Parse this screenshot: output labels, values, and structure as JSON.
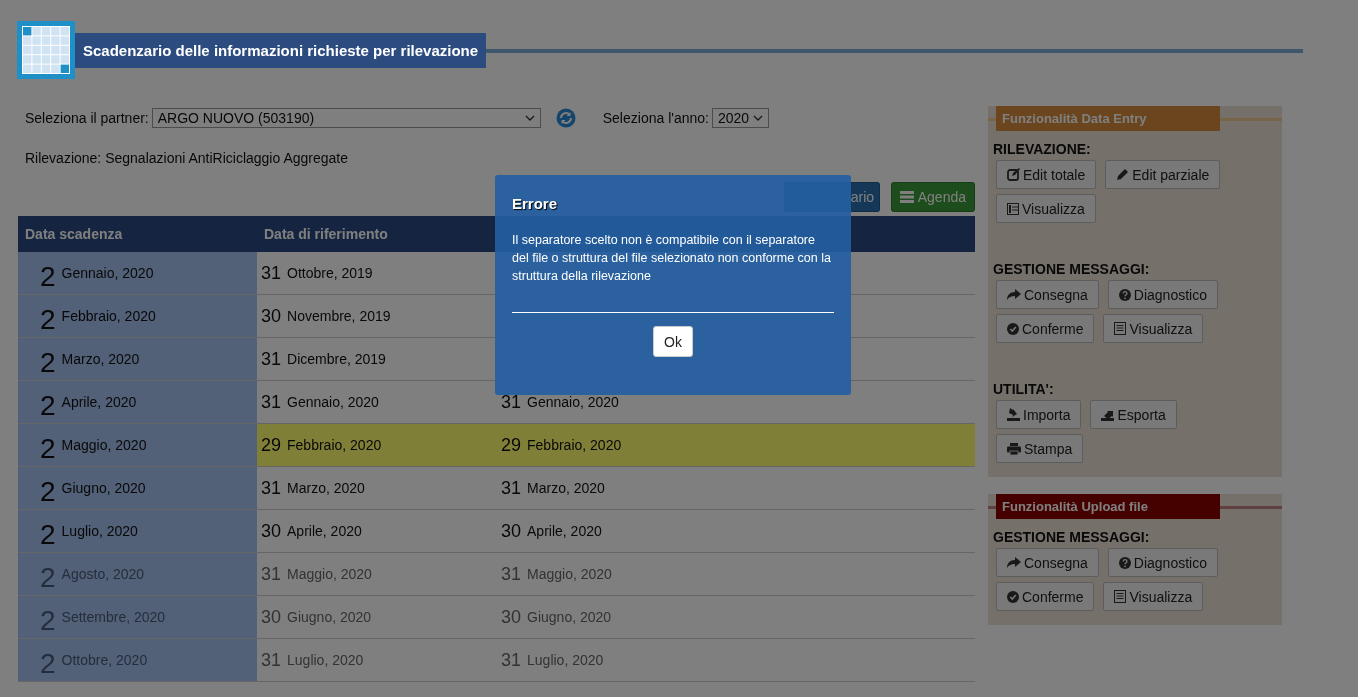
{
  "header": {
    "title": "Scadenzario delle informazioni richieste per rilevazione"
  },
  "filters": {
    "partner_label": "Seleziona il partner:",
    "partner_value": "ARGO NUOVO (503190)",
    "year_label": "Seleziona l'anno:",
    "year_value": "2020"
  },
  "survey": "Rilevazione: Segnalazioni AntiRiciclaggio Aggregate",
  "view_buttons": [
    {
      "label": "ario",
      "kind": "calendar"
    },
    {
      "label": "Agenda",
      "kind": "agenda"
    }
  ],
  "table": {
    "columns": [
      "Data scadenza",
      "Data di riferimento"
    ],
    "rows": [
      {
        "deadline_day": "2",
        "deadline_month": "Gennaio, 2020",
        "ref_day": "31",
        "ref_month": "Ottobre, 2019",
        "past": false,
        "highlighted": false
      },
      {
        "deadline_day": "2",
        "deadline_month": "Febbraio, 2020",
        "ref_day": "30",
        "ref_month": "Novembre, 2019",
        "past": false,
        "highlighted": false
      },
      {
        "deadline_day": "2",
        "deadline_month": "Marzo, 2020",
        "ref_day": "31",
        "ref_month": "Dicembre, 2019",
        "past": false,
        "highlighted": false
      },
      {
        "deadline_day": "2",
        "deadline_month": "Aprile, 2020",
        "ref_day": "31",
        "ref_month": "Gennaio, 2020",
        "col3_day": "31",
        "col3_month": "Gennaio, 2020",
        "past": false,
        "highlighted": false
      },
      {
        "deadline_day": "2",
        "deadline_month": "Maggio, 2020",
        "ref_day": "29",
        "ref_month": "Febbraio, 2020",
        "col3_day": "29",
        "col3_month": "Febbraio, 2020",
        "past": false,
        "highlighted": true
      },
      {
        "deadline_day": "2",
        "deadline_month": "Giugno, 2020",
        "ref_day": "31",
        "ref_month": "Marzo, 2020",
        "col3_day": "31",
        "col3_month": "Marzo, 2020",
        "past": false,
        "highlighted": false
      },
      {
        "deadline_day": "2",
        "deadline_month": "Luglio, 2020",
        "ref_day": "30",
        "ref_month": "Aprile, 2020",
        "col3_day": "30",
        "col3_month": "Aprile, 2020",
        "past": false,
        "highlighted": false
      },
      {
        "deadline_day": "2",
        "deadline_month": "Agosto, 2020",
        "ref_day": "31",
        "ref_month": "Maggio, 2020",
        "col3_day": "31",
        "col3_month": "Maggio, 2020",
        "past": true,
        "highlighted": false
      },
      {
        "deadline_day": "2",
        "deadline_month": "Settembre, 2020",
        "ref_day": "30",
        "ref_month": "Giugno, 2020",
        "col3_day": "30",
        "col3_month": "Giugno, 2020",
        "past": true,
        "highlighted": false
      },
      {
        "deadline_day": "2",
        "deadline_month": "Ottobre, 2020",
        "ref_day": "31",
        "ref_month": "Luglio, 2020",
        "col3_day": "31",
        "col3_month": "Luglio, 2020",
        "past": true,
        "highlighted": false
      }
    ]
  },
  "panels": [
    {
      "title": "Funzionalità Data Entry",
      "kind": "data_entry",
      "sections": [
        {
          "heading": "RILEVAZIONE:",
          "buttons": [
            {
              "label": "Edit totale",
              "kind": "edit"
            },
            {
              "label": "Edit parziale",
              "kind": "pencil"
            },
            {
              "label": "Visualizza",
              "kind": "table"
            }
          ]
        },
        {
          "heading": "GESTIONE MESSAGGI:",
          "buttons": [
            {
              "label": "Consegna",
              "kind": "share"
            },
            {
              "label": "Diagnostico",
              "kind": "question"
            },
            {
              "label": "Conferme",
              "kind": "check"
            },
            {
              "label": "Visualizza",
              "kind": "list"
            }
          ]
        },
        {
          "heading": "UTILITA':",
          "buttons": [
            {
              "label": "Importa",
              "kind": "import"
            },
            {
              "label": "Esporta",
              "kind": "export"
            },
            {
              "label": "Stampa",
              "kind": "print"
            }
          ]
        }
      ]
    },
    {
      "title": "Funzionalità Upload file",
      "kind": "upload",
      "sections": [
        {
          "heading": "GESTIONE MESSAGGI:",
          "buttons": [
            {
              "label": "Consegna",
              "kind": "share"
            },
            {
              "label": "Diagnostico",
              "kind": "question"
            },
            {
              "label": "Conferme",
              "kind": "check"
            },
            {
              "label": "Visualizza",
              "kind": "list"
            }
          ]
        }
      ]
    }
  ],
  "modal": {
    "title": "Errore",
    "message": "Il separatore scelto non è compatibile con il separatore del file o struttura del file selezionato non conforme con la struttura della rilevazione",
    "button": "Ok"
  }
}
